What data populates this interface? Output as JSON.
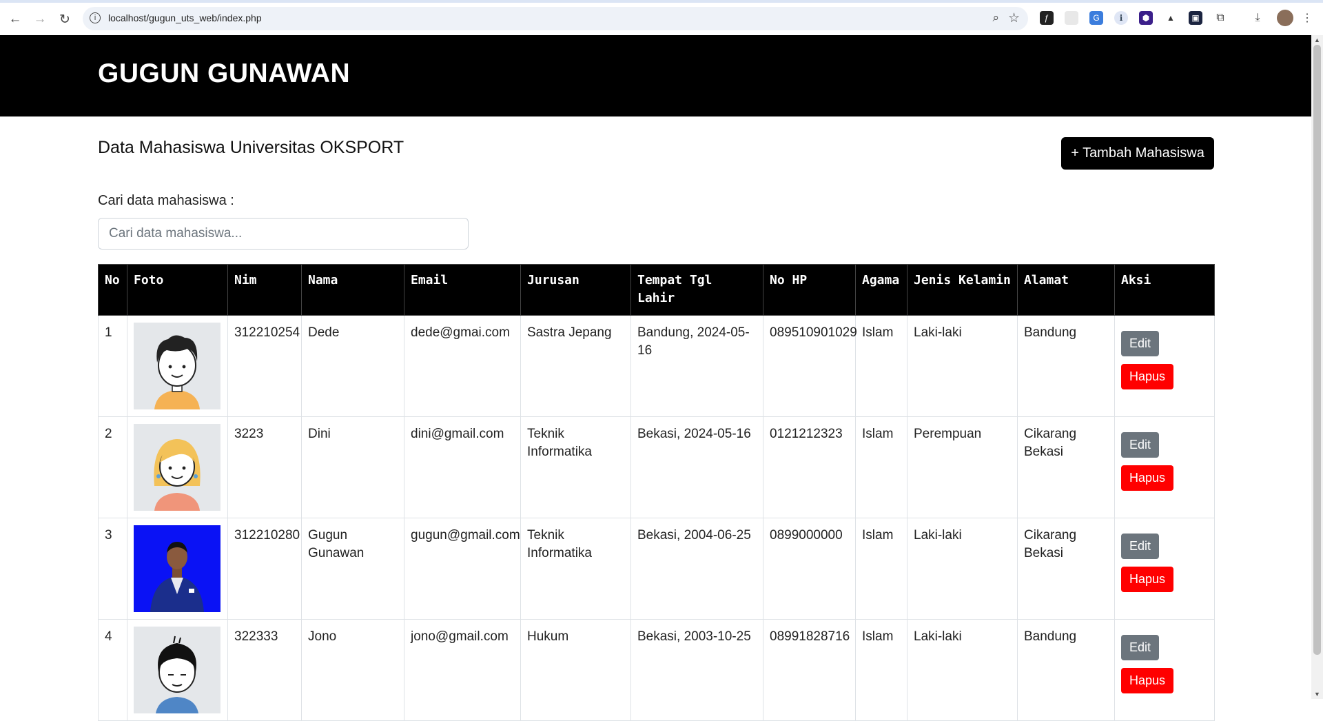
{
  "browser": {
    "url": "localhost/gugun_uts_web/index.php"
  },
  "header": {
    "title": "GUGUN GUNAWAN"
  },
  "main": {
    "page_title": "Data Mahasiswa Universitas OKSPORT",
    "add_button": "+ Tambah Mahasiswa",
    "search_label": "Cari data mahasiswa :",
    "search_placeholder": "Cari data mahasiswa..."
  },
  "table": {
    "headers": [
      "No",
      "Foto",
      "Nim",
      "Nama",
      "Email",
      "Jurusan",
      "Tempat Tgl Lahir",
      "No HP",
      "Agama",
      "Jenis Kelamin",
      "Alamat",
      "Aksi"
    ],
    "edit_label": "Edit",
    "delete_label": "Hapus",
    "rows": [
      {
        "no": "1",
        "nim": "312210254",
        "nama": "Dede",
        "email": "dede@gmai.com",
        "jurusan": "Sastra Jepang",
        "ttl": "Bandung, 2024-05-16",
        "hp": "089510901029",
        "agama": "Islam",
        "jk": "Laki-laki",
        "alamat": "Bandung"
      },
      {
        "no": "2",
        "nim": "3223",
        "nama": "Dini",
        "email": "dini@gmail.com",
        "jurusan": "Teknik Informatika",
        "ttl": "Bekasi, 2024-05-16",
        "hp": "0121212323",
        "agama": "Islam",
        "jk": "Perempuan",
        "alamat": "Cikarang Bekasi"
      },
      {
        "no": "3",
        "nim": "312210280",
        "nama": "Gugun Gunawan",
        "email": "gugun@gmail.com",
        "jurusan": "Teknik Informatika",
        "ttl": "Bekasi, 2004-06-25",
        "hp": "0899000000",
        "agama": "Islam",
        "jk": "Laki-laki",
        "alamat": "Cikarang Bekasi"
      },
      {
        "no": "4",
        "nim": "322333",
        "nama": "Jono",
        "email": "jono@gmail.com",
        "jurusan": "Hukum",
        "ttl": "Bekasi, 2003-10-25",
        "hp": "08991828716",
        "agama": "Islam",
        "jk": "Laki-laki",
        "alamat": "Bandung"
      }
    ]
  },
  "colors": {
    "header_bg": "#000000",
    "edit_button": "#6c757d",
    "delete_button": "#ff0000",
    "photo_blue_bg": "#0a12f5"
  }
}
